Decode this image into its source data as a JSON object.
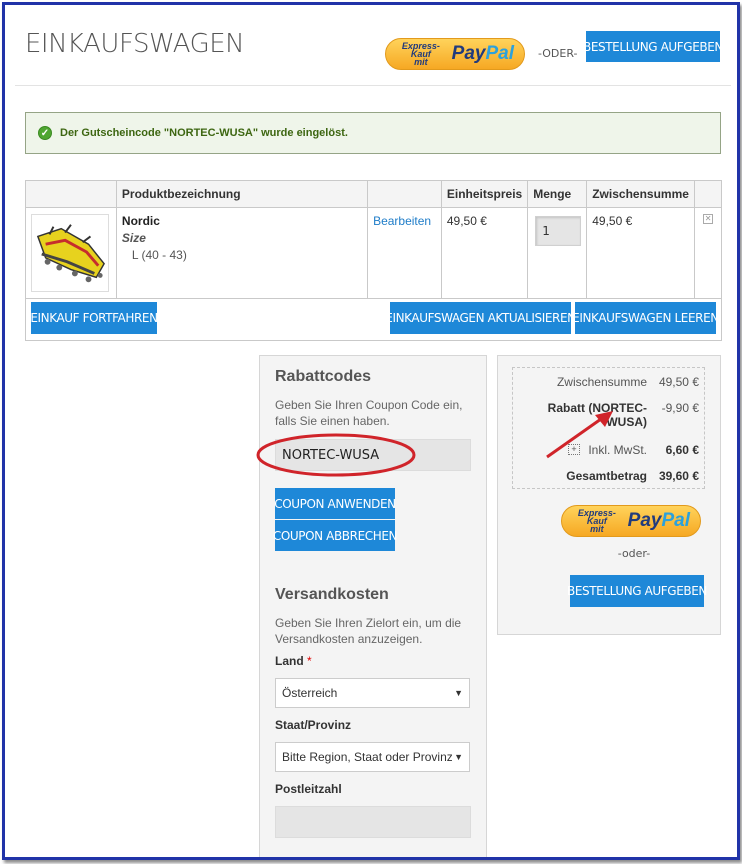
{
  "header": {
    "title": "EINKAUFSWAGEN",
    "paypal_express": "Express-Kauf",
    "paypal_mit": "mit",
    "paypal_brand_1": "Pay",
    "paypal_brand_2": "Pal",
    "oder": "-ODER-",
    "checkout_label": "BESTELLUNG AUFGEBEN"
  },
  "message": {
    "text": "Der Gutscheincode \"NORTEC-WUSA\" wurde eingelöst."
  },
  "cart": {
    "columns": [
      "Produktbezeichnung",
      "Einheitspreis",
      "Menge",
      "Zwischensumme"
    ],
    "items": [
      {
        "name": "Nordic",
        "option_label": "Size",
        "option_value": "L (40 - 43)",
        "edit_label": "Bearbeiten",
        "unit_price": "49,50 €",
        "qty": "1",
        "subtotal": "49,50 €",
        "remove_icon": "close-icon"
      }
    ],
    "continue_label": "EINKAUF FORTFAHREN",
    "update_label": "EINKAUFSWAGEN AKTUALISIEREN",
    "clear_label": "EINKAUFSWAGEN LEEREN"
  },
  "coupon": {
    "title": "Rabattcodes",
    "description": "Geben Sie Ihren Coupon Code ein, falls Sie einen haben.",
    "code": "NORTEC-WUSA",
    "apply_label": "COUPON ANWENDEN",
    "cancel_label": "COUPON ABBRECHEN"
  },
  "shipping": {
    "title": "Versandkosten",
    "description": "Geben Sie Ihren Zielort ein, um die Versandkosten anzuzeigen.",
    "country_label": "Land",
    "required_mark": "*",
    "country_value": "Österreich",
    "region_label": "Staat/Provinz",
    "region_value": "Bitte Region, Staat oder Provinz",
    "zip_label": "Postleitzahl",
    "zip_value": ""
  },
  "totals": {
    "subtotal_label": "Zwischensumme",
    "subtotal_value": "49,50 €",
    "discount_label_1": "Rabatt (NORTEC-",
    "discount_label_2": "WUSA)",
    "discount_value": "-9,90 €",
    "tax_label": "Inkl. MwSt.",
    "tax_value": "6,60 €",
    "grand_label": "Gesamtbetrag",
    "grand_value": "39,60 €",
    "oder": "-oder-",
    "checkout_label": "BESTELLUNG AUFGEBEN"
  },
  "colors": {
    "accent": "#1e88d8",
    "frame": "#2033a8",
    "annotation": "#d0242a"
  }
}
